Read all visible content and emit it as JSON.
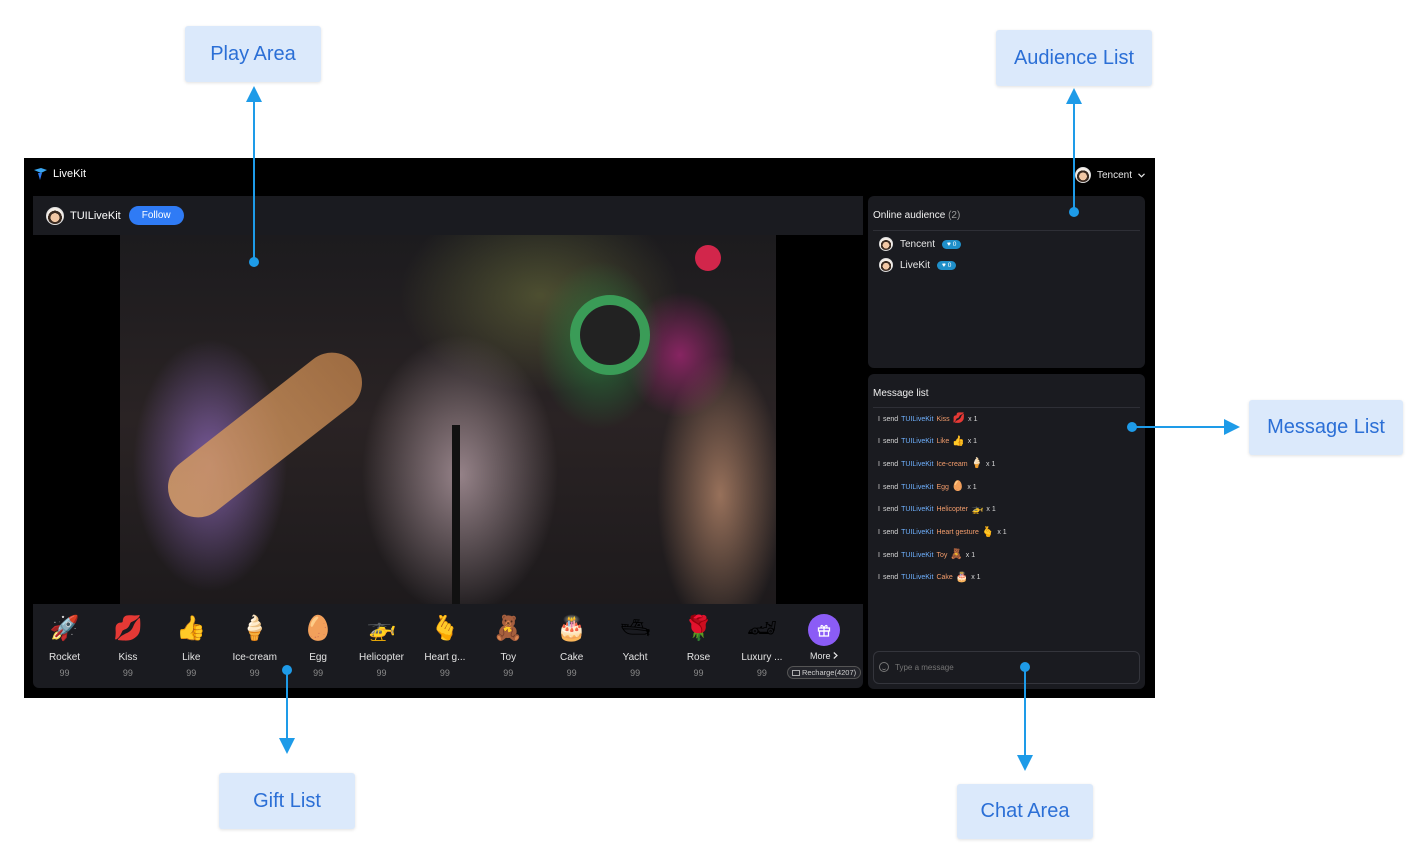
{
  "callouts": {
    "play_area": "Play Area",
    "audience_list": "Audience List",
    "message_list": "Message List",
    "gift_list": "Gift List",
    "chat_area": "Chat Area"
  },
  "app": {
    "logo_text": "LiveKit",
    "user_name": "Tencent"
  },
  "anchor": {
    "name": "TUILiveKit",
    "follow_label": "Follow"
  },
  "gifts": [
    {
      "name": "Rocket",
      "price": "99",
      "icon": "rocket-icon",
      "glyph": "🚀"
    },
    {
      "name": "Kiss",
      "price": "99",
      "icon": "kiss-icon",
      "glyph": "💋"
    },
    {
      "name": "Like",
      "price": "99",
      "icon": "thumbs-up-icon",
      "glyph": "👍"
    },
    {
      "name": "Ice-cream",
      "price": "99",
      "icon": "ice-cream-icon",
      "glyph": "🍦"
    },
    {
      "name": "Egg",
      "price": "99",
      "icon": "egg-icon",
      "glyph": "🥚"
    },
    {
      "name": "Helicopter",
      "price": "99",
      "icon": "helicopter-icon",
      "glyph": "🚁"
    },
    {
      "name": "Heart g...",
      "price": "99",
      "icon": "heart-gesture-icon",
      "glyph": "🫰"
    },
    {
      "name": "Toy",
      "price": "99",
      "icon": "teddy-bear-icon",
      "glyph": "🧸"
    },
    {
      "name": "Cake",
      "price": "99",
      "icon": "cake-icon",
      "glyph": "🎂"
    },
    {
      "name": "Yacht",
      "price": "99",
      "icon": "yacht-icon",
      "glyph": "🛥"
    },
    {
      "name": "Rose",
      "price": "99",
      "icon": "rose-icon",
      "glyph": "🌹"
    },
    {
      "name": "Luxury ...",
      "price": "99",
      "icon": "luxury-car-icon",
      "glyph": "🏎"
    }
  ],
  "gift_more": {
    "label": "More",
    "recharge_label": "Recharge(4207)"
  },
  "audience": {
    "title": "Online audience",
    "count": "(2)",
    "members": [
      {
        "name": "Tencent",
        "level": "0"
      },
      {
        "name": "LiveKit",
        "level": "0"
      }
    ]
  },
  "messages": {
    "title": "Message list",
    "items": [
      {
        "self": "I",
        "verb": "send",
        "sender": "TUILiveKit",
        "gift": "Kiss",
        "glyph": "💋",
        "count": "x 1"
      },
      {
        "self": "I",
        "verb": "send",
        "sender": "TUILiveKit",
        "gift": "Like",
        "glyph": "👍",
        "count": "x 1"
      },
      {
        "self": "I",
        "verb": "send",
        "sender": "TUILiveKit",
        "gift": "Ice-cream",
        "glyph": "🍦",
        "count": "x 1"
      },
      {
        "self": "I",
        "verb": "send",
        "sender": "TUILiveKit",
        "gift": "Egg",
        "glyph": "🥚",
        "count": "x 1"
      },
      {
        "self": "I",
        "verb": "send",
        "sender": "TUILiveKit",
        "gift": "Helicopter",
        "glyph": "🚁",
        "count": "x 1"
      },
      {
        "self": "I",
        "verb": "send",
        "sender": "TUILiveKit",
        "gift": "Heart gesture",
        "glyph": "🫰",
        "count": "x 1"
      },
      {
        "self": "I",
        "verb": "send",
        "sender": "TUILiveKit",
        "gift": "Toy",
        "glyph": "🧸",
        "count": "x 1"
      },
      {
        "self": "I",
        "verb": "send",
        "sender": "TUILiveKit",
        "gift": "Cake",
        "glyph": "🎂",
        "count": "x 1"
      }
    ]
  },
  "chat": {
    "placeholder": "Type a message"
  },
  "colors": {
    "accent": "#2f7bf5",
    "callout_bg": "#dbe9fb",
    "callout_text": "#2b6fd6",
    "arrow": "#1e9be8",
    "panel_bg": "#1a1b20",
    "more_button": "#8b5cf6",
    "level_badge": "#1f8fc9"
  }
}
